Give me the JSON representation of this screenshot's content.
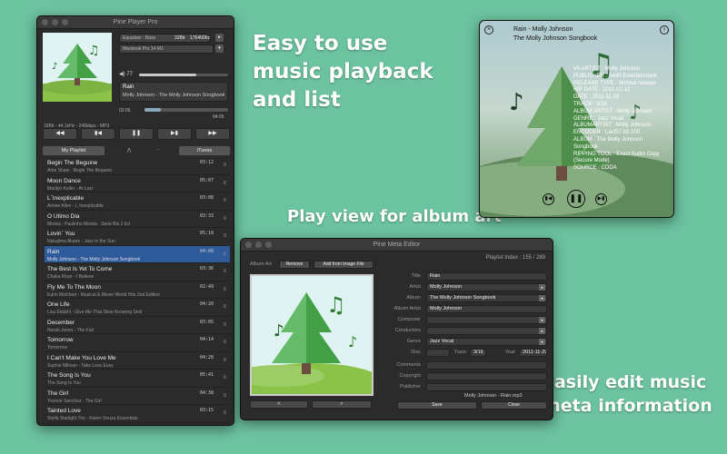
{
  "colors": {
    "background": "#6cc3a0",
    "selection": "#2f5b9a",
    "window": "#2b2b2b"
  },
  "captions": {
    "playback": "Easy to use music playback and list",
    "album_art": "Play view for album art",
    "meta_line1": "Easily edit music",
    "meta_line2": "meta information"
  },
  "player": {
    "title": "Pine Player Pro",
    "equalizer": "Equalizer : Bass",
    "bitdepth": "32Bit",
    "samplerate": "176400hz",
    "device": "Macbook Pro 14 M1",
    "volume": "77",
    "volume_level": 0.64,
    "now_playing_title": "Rain",
    "now_playing_sub": "Molly Johnson - The Molly Johnson Songbook",
    "time_elapsed": "02:05",
    "time_total": "04:05",
    "progress": 0.2,
    "format": "16Bit - 44.1kHz - 248kbps - MP3",
    "tab_playlist": "My Playlist",
    "tab_itunes": "iTunes",
    "tracks": [
      {
        "title": "Begin The Beguine",
        "sub": "Artie Shaw  -  Begin The Beguine",
        "dur": "03:12"
      },
      {
        "title": "Moon Dance",
        "sub": "Marilyn Keller  -  At Last",
        "dur": "05:07"
      },
      {
        "title": "L`Inexplicable",
        "sub": "Aimee Allen  -  L`Inexplicable",
        "dur": "03:08"
      },
      {
        "title": "O Utimo Dia",
        "sub": "Moska  -  Paulinho Moska - Serie Bis 2 Ed",
        "dur": "03:33"
      },
      {
        "title": "Lovin` You",
        "sub": "Nakajima Akane  -  Jazz in the Sun",
        "dur": "05:18"
      },
      {
        "title": "Rain",
        "sub": "Molly Johnson  -  The Molly Johnson Songbook",
        "dur": "04:00"
      },
      {
        "title": "The Best Is Yet To Come",
        "sub": "Chaka Khan  -  I Believe",
        "dur": "03:36"
      },
      {
        "title": "Fly Me To The Moon",
        "sub": "Karin Melchert  -  Musical & Movie World Hits 2nd Edition",
        "dur": "02:49"
      },
      {
        "title": "One Life",
        "sub": "Lisa Ekdahl  -  Give Me That Slow Knowing Smil",
        "dur": "04:20"
      },
      {
        "title": "December",
        "sub": "Norah Jones  -  The Fall",
        "dur": "03:05"
      },
      {
        "title": "Tomorrow",
        "sub": "Tomorrow",
        "dur": "04:14"
      },
      {
        "title": "I Can't Make You Love Me",
        "sub": "Sophie Milman  -  Take Love Easy",
        "dur": "04:28"
      },
      {
        "title": "The Song Is You",
        "sub": "The Song Is You",
        "dur": "05:41"
      },
      {
        "title": "The Girl",
        "sub": "Yvonne Sanchez  -  The Girl",
        "dur": "04:38"
      },
      {
        "title": "Tainted Love",
        "sub": "Stella Starlight Trio  -  Karen Souza Essentials",
        "dur": "03:15"
      },
      {
        "title": "Alone",
        "sub": "Jesse Cook  -  Frontiers",
        "dur": "02:28"
      }
    ]
  },
  "artview": {
    "title": "Rain - Molly Johnson",
    "album": "The Molly Johnson Songbook",
    "meta": [
      "VA ARTIST : Molly Johnson",
      "PUBLISHER : A440 Entertainment",
      "RELEASE TYPE : Normal release",
      "RIP DATE : 2011-12-12",
      "DATE : 2011-11-29",
      "TRACK : 3/16",
      "ALBUM ARTIST : Molly Johnson",
      "GENRE : Jazz Vocal",
      "ALBUMARTIST : Molly Johnson",
      "ENCODER : Lavf57.83.100",
      "ALBUM : The Molly Johnson",
      "Songbook",
      "RIPPING TOOL : Exact Audio Copy",
      "(Secure Mode)",
      "SOURCE : CDDA"
    ]
  },
  "editor": {
    "title": "Pine Meta Editor",
    "playlist_index": "Playlist Index : 155 / 289",
    "album_art_label": "Album Art",
    "remove_btn": "Remove",
    "add_image_btn": "Add from Image File",
    "prev_btn": "<",
    "next_btn": ">",
    "labels": {
      "title": "Title",
      "artist": "Artist",
      "album": "Album",
      "album_artist": "Album Artist",
      "composer": "Composer",
      "conductors": "Conductors",
      "genre": "Genre",
      "disc": "Disc",
      "track": "Track",
      "year": "Year",
      "comments": "Comments",
      "copyright": "Copyright",
      "publisher": "Publisher"
    },
    "values": {
      "title": "Rain",
      "artist": "Molly Johnson",
      "album": "The Molly Johnson Songbook",
      "album_artist": "Molly Johnson",
      "composer": "",
      "conductors": "",
      "genre": "Jazz Vocal",
      "disc": "",
      "track": "3/16",
      "year": "2011-11-29",
      "comments": "",
      "copyright": "",
      "publisher": ""
    },
    "filename": "Molly Johnson - Rain.mp3",
    "save_btn": "Save",
    "close_btn": "Close"
  }
}
